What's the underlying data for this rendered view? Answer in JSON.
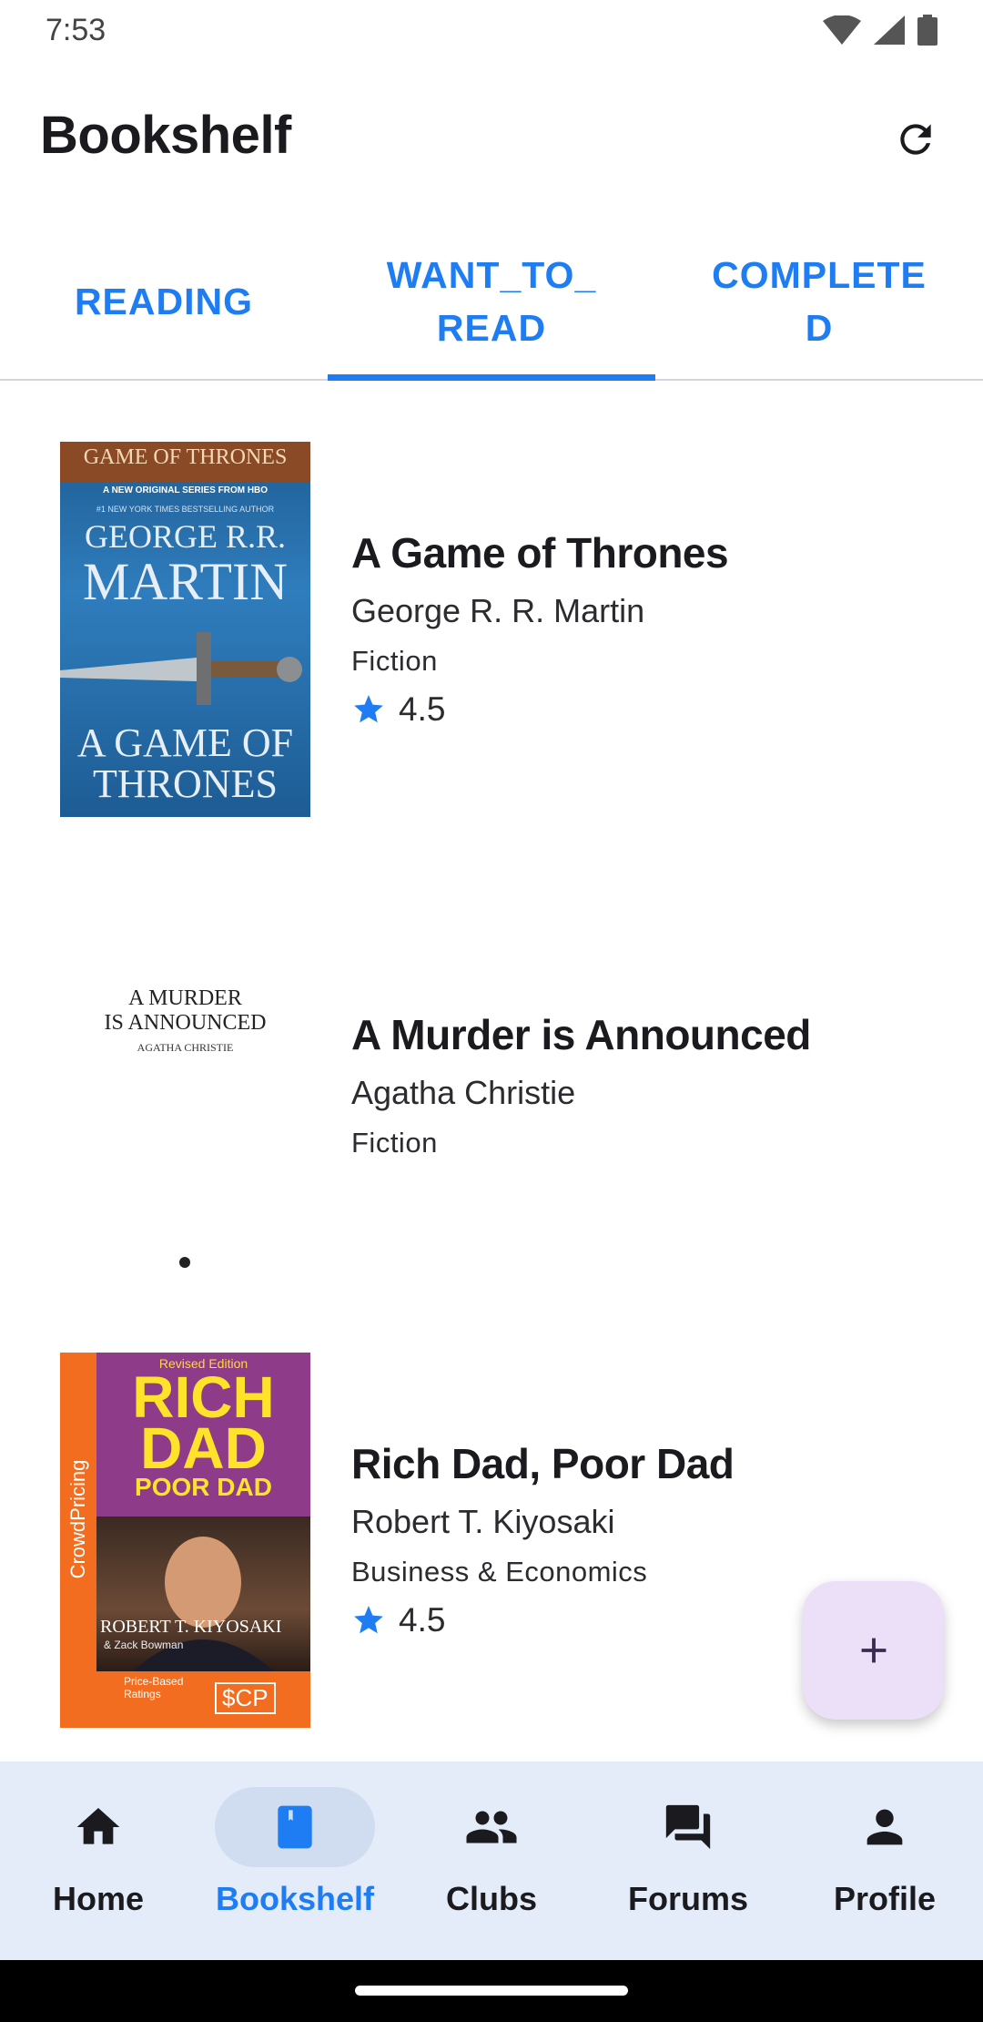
{
  "status_bar": {
    "time": "7:53"
  },
  "app_bar": {
    "title": "Bookshelf",
    "refresh_icon": "refresh-icon"
  },
  "tabs": [
    {
      "label": "READING",
      "active": false
    },
    {
      "label": "WANT_TO_READ",
      "active": true
    },
    {
      "label": "COMPLETED",
      "active": false
    }
  ],
  "books": [
    {
      "title": "A Game of Thrones",
      "author": "George R. R. Martin",
      "category": "Fiction",
      "rating": "4.5",
      "cover": {
        "series": "GAME OF THRONES",
        "tagline": "A NEW ORIGINAL SERIES FROM HBO",
        "subtag": "#1 NEW YORK TIMES BESTSELLING AUTHOR",
        "author_line1": "GEORGE R.R.",
        "author_line2": "MARTIN",
        "title_line1": "A GAME OF",
        "title_line2": "THRONES"
      }
    },
    {
      "title": "A Murder is Announced",
      "author": "Agatha Christie",
      "category": "Fiction",
      "rating": "",
      "cover": {
        "title_line1": "A MURDER",
        "title_line2": "IS ANNOUNCED",
        "author": "AGATHA CHRISTIE"
      }
    },
    {
      "title": "Rich Dad, Poor Dad",
      "author": "Robert T. Kiyosaki",
      "category": "Business & Economics",
      "rating": "4.5",
      "cover": {
        "edition": "Revised Edition",
        "word1": "RICH",
        "word2": "DAD",
        "word3": "POOR DAD",
        "side": "CrowdPricing",
        "author_name": "ROBERT T. KIYOSAKI",
        "coauthor": "& Zack Bowman",
        "badge": "Price-Based Ratings",
        "logo": "$CP"
      }
    }
  ],
  "fab": {
    "icon": "plus-icon"
  },
  "bottom_nav": [
    {
      "label": "Home",
      "icon": "home-icon",
      "active": false
    },
    {
      "label": "Bookshelf",
      "icon": "bookmark-icon",
      "active": true
    },
    {
      "label": "Clubs",
      "icon": "group-icon",
      "active": false
    },
    {
      "label": "Forums",
      "icon": "forum-icon",
      "active": false
    },
    {
      "label": "Profile",
      "icon": "person-icon",
      "active": false
    }
  ],
  "colors": {
    "accent": "#1e7df2",
    "nav_background": "#e3ecf8",
    "fab_background": "#ecdff8"
  }
}
